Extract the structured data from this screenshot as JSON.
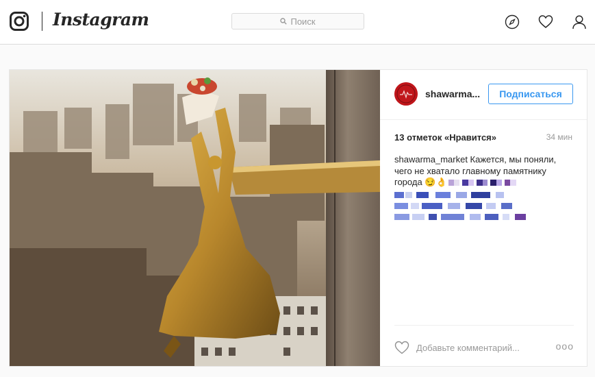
{
  "app": {
    "wordmark": "Instagram"
  },
  "search": {
    "placeholder": "Поиск"
  },
  "nav": {
    "icons": [
      "compass-icon",
      "heart-icon",
      "profile-icon"
    ]
  },
  "post": {
    "username": "shawarma...",
    "follow_label": "Подписаться",
    "likes": "13 отметок «Нравится»",
    "time": "34 мин",
    "caption_user": "shawarma_market",
    "caption_text": " Кажется, мы поняли, чего не хватало главному памятнику города ",
    "comment_placeholder": "Добавьте комментарий...",
    "more_label": "ooo"
  },
  "colors": {
    "accent": "#3897f0",
    "border": "#dbdbdb",
    "avatar": "#c0161b",
    "text": "#262626",
    "muted": "#999999"
  }
}
